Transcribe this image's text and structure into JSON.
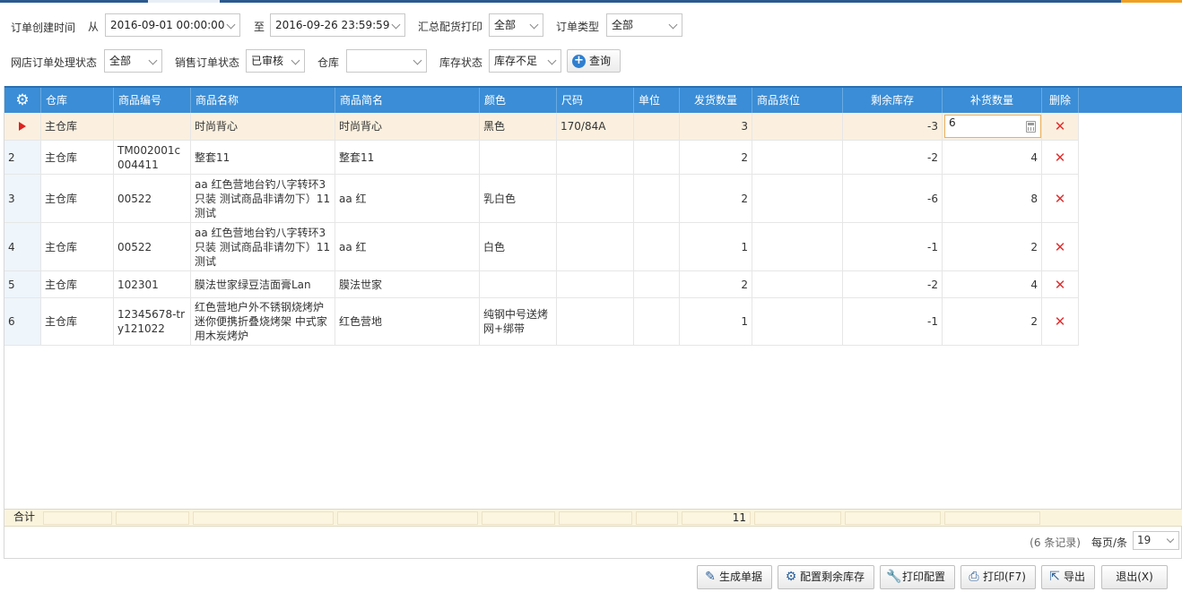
{
  "filters": {
    "created_label": "订单创建时间",
    "from_label": "从",
    "from_value": "2016-09-01 00:00:00",
    "to_label": "至",
    "to_value": "2016-09-26 23:59:59",
    "summary_print_label": "汇总配货打印",
    "summary_print_value": "全部",
    "order_type_label": "订单类型",
    "order_type_value": "全部",
    "shop_status_label": "网店订单处理状态",
    "shop_status_value": "全部",
    "sales_status_label": "销售订单状态",
    "sales_status_value": "已审核",
    "warehouse_label": "仓库",
    "warehouse_value": "",
    "stock_status_label": "库存状态",
    "stock_status_value": "库存不足",
    "query_label": "查询"
  },
  "table": {
    "headers": {
      "warehouse": "仓库",
      "code": "商品编号",
      "name": "商品名称",
      "short": "商品简名",
      "color": "颜色",
      "size": "尺码",
      "unit": "单位",
      "ship_qty": "发货数量",
      "location": "商品货位",
      "remain": "剩余库存",
      "replenish": "补货数量",
      "delete": "删除"
    },
    "rows": [
      {
        "idx": "",
        "warehouse": "主仓库",
        "code": "",
        "name": "时尚背心",
        "short": "时尚背心",
        "color": "黑色",
        "size": "170/84A",
        "unit": "",
        "ship_qty": "3",
        "location": "",
        "remain": "-3",
        "replenish": "6"
      },
      {
        "idx": "2",
        "warehouse": "主仓库",
        "code": "TM002001c004411",
        "name": "整套11",
        "short": "整套11",
        "color": "",
        "size": "",
        "unit": "",
        "ship_qty": "2",
        "location": "",
        "remain": "-2",
        "replenish": "4"
      },
      {
        "idx": "3",
        "warehouse": "主仓库",
        "code": "00522",
        "name": "aa 红色营地台钓八字转环3只装 测试商品非请勿下）11测试",
        "short": "aa 红",
        "color": "乳白色",
        "size": "",
        "unit": "",
        "ship_qty": "2",
        "location": "",
        "remain": "-6",
        "replenish": "8"
      },
      {
        "idx": "4",
        "warehouse": "主仓库",
        "code": "00522",
        "name": "aa 红色营地台钓八字转环3只装 测试商品非请勿下）11测试",
        "short": "aa 红",
        "color": "白色",
        "size": "",
        "unit": "",
        "ship_qty": "1",
        "location": "",
        "remain": "-1",
        "replenish": "2"
      },
      {
        "idx": "5",
        "warehouse": "主仓库",
        "code": "102301",
        "name": "膜法世家绿豆洁面膏Lan",
        "short": "膜法世家",
        "color": "",
        "size": "",
        "unit": "",
        "ship_qty": "2",
        "location": "",
        "remain": "-2",
        "replenish": "4"
      },
      {
        "idx": "6",
        "warehouse": "主仓库",
        "code": "12345678-try121022",
        "name": "红色营地户外不锈钢烧烤炉迷你便携折叠烧烤架 中式家用木炭烤炉",
        "short": "红色营地",
        "color": "纯钢中号送烤网+绑带",
        "size": "",
        "unit": "",
        "ship_qty": "1",
        "location": "",
        "remain": "-1",
        "replenish": "2"
      }
    ],
    "footer": {
      "label": "合计",
      "ship_qty_total": "11"
    }
  },
  "pager": {
    "records": "(6 条记录)",
    "per_page_label": "每页/条",
    "per_page_value": "19"
  },
  "actions": {
    "generate": "生成单据",
    "config_stock": "配置剩余库存",
    "print_config": "打印配置",
    "print": "打印(F7)",
    "export": "导出",
    "exit": "退出(X)"
  }
}
